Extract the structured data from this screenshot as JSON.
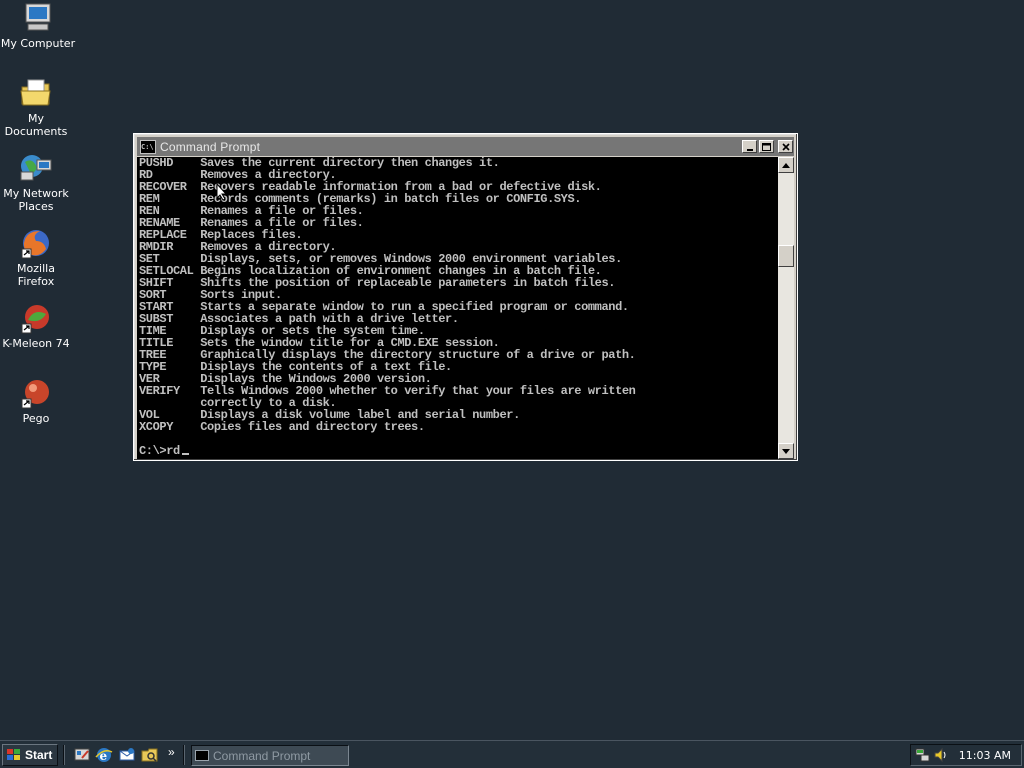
{
  "desktop": {
    "icons": [
      {
        "name": "computer-icon",
        "label": "My Computer"
      },
      {
        "name": "folder-icon",
        "label": "My Documents"
      },
      {
        "name": "network-icon",
        "label": "My Network Places"
      },
      {
        "name": "firefox-icon",
        "label": "Mozilla Firefox"
      },
      {
        "name": "kmeleon-icon",
        "label": "K-Meleon 74"
      },
      {
        "name": "pego-icon",
        "label": "Pego"
      }
    ]
  },
  "window": {
    "title": "Command Prompt",
    "icon_text": "C:\\",
    "console_lines": [
      "PUSHD    Saves the current directory then changes it.",
      "RD       Removes a directory.",
      "RECOVER  Recovers readable information from a bad or defective disk.",
      "REM      Records comments (remarks) in batch files or CONFIG.SYS.",
      "REN      Renames a file or files.",
      "RENAME   Renames a file or files.",
      "REPLACE  Replaces files.",
      "RMDIR    Removes a directory.",
      "SET      Displays, sets, or removes Windows 2000 environment variables.",
      "SETLOCAL Begins localization of environment changes in a batch file.",
      "SHIFT    Shifts the position of replaceable parameters in batch files.",
      "SORT     Sorts input.",
      "START    Starts a separate window to run a specified program or command.",
      "SUBST    Associates a path with a drive letter.",
      "TIME     Displays or sets the system time.",
      "TITLE    Sets the window title for a CMD.EXE session.",
      "TREE     Graphically displays the directory structure of a drive or path.",
      "TYPE     Displays the contents of a text file.",
      "VER      Displays the Windows 2000 version.",
      "VERIFY   Tells Windows 2000 whether to verify that your files are written",
      "         correctly to a disk.",
      "VOL      Displays a disk volume label and serial number.",
      "XCOPY    Copies files and directory trees."
    ],
    "prompt": "C:\\>rd"
  },
  "taskbar": {
    "start_label": "Start",
    "task_label": "Command Prompt",
    "chevron": "»",
    "clock": "11:03 AM"
  }
}
